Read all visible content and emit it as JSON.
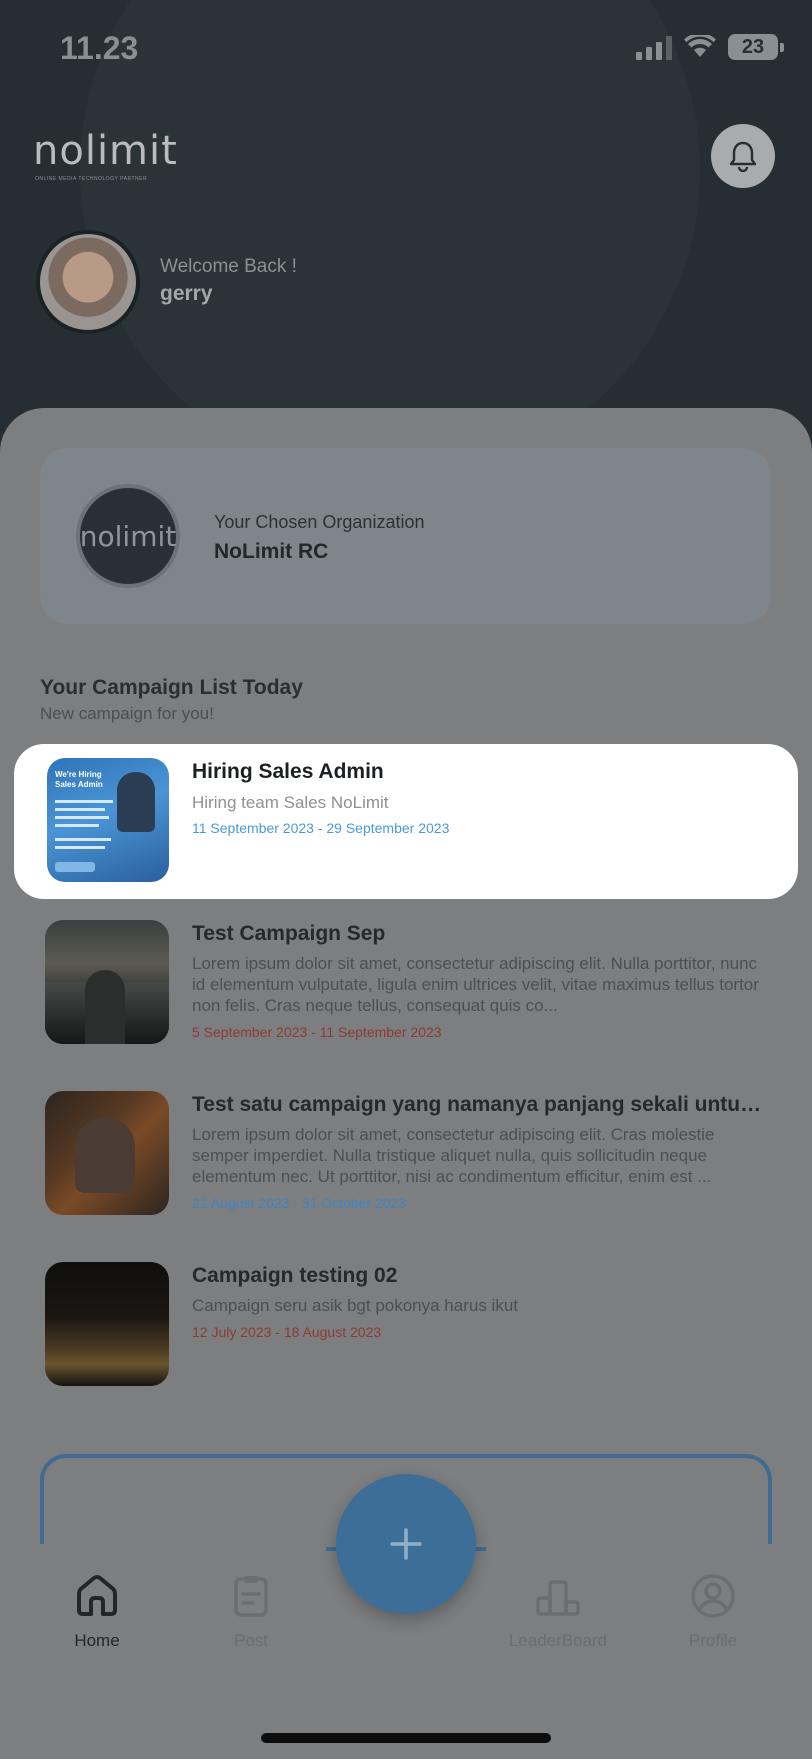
{
  "status_bar": {
    "time": "11.23",
    "battery": "23",
    "icons": [
      "signal-icon",
      "wifi-icon",
      "battery-icon"
    ]
  },
  "header": {
    "logo_text": "nolimit",
    "logo_tagline": "ONLINE MEDIA TECHNOLOGY PARTNER",
    "bell_icon": "bell-icon",
    "welcome": "Welcome Back !",
    "username": "gerry"
  },
  "organization": {
    "label": "Your Chosen Organization",
    "name": "NoLimit RC",
    "avatar_text": "nolimit"
  },
  "campaign_section": {
    "title": "Your Campaign List Today",
    "subtitle": "New campaign for you!"
  },
  "campaigns": [
    {
      "title": "Hiring Sales Admin",
      "description": "Hiring team Sales NoLimit",
      "date": "11 September 2023 - 29 September 2023",
      "date_color": "blue",
      "highlighted": true,
      "thumb_text": "We're Hiring Sales Admin"
    },
    {
      "title": "Test Campaign Sep",
      "description": "Lorem ipsum dolor sit amet, consectetur adipiscing elit. Nulla porttitor, nunc id elementum vulputate, ligula enim ultrices velit, vitae maximus tellus tortor non felis. Cras neque tellus, consequat quis co...",
      "date": "5 September 2023 - 11 September 2023",
      "date_color": "red",
      "highlighted": false
    },
    {
      "title": "Test satu campaign yang namanya panjang sekali untuk ...",
      "description": "Lorem ipsum dolor sit amet, consectetur adipiscing elit. Cras molestie semper imperdiet. Nulla tristique aliquet nulla, quis sollicitudin neque elementum nec. Ut porttitor, nisi ac condimentum efficitur, enim est ...",
      "date": "21 August 2023 - 31 October 2023",
      "date_color": "blue",
      "highlighted": false
    },
    {
      "title": "Campaign testing 02",
      "description": "Campaign seru asik bgt pokonya harus ikut",
      "date": "12 July 2023 - 18 August 2023",
      "date_color": "red",
      "highlighted": false
    }
  ],
  "nav": {
    "home": "Home",
    "post": "Post",
    "leaderboard": "LeaderBoard",
    "profile": "Profile",
    "fab_icon": "plus-icon"
  },
  "colors": {
    "accent": "#3d6e97",
    "header_bg": "#262e33",
    "date_blue": "#3d85c6",
    "date_red": "#8c3a34"
  }
}
